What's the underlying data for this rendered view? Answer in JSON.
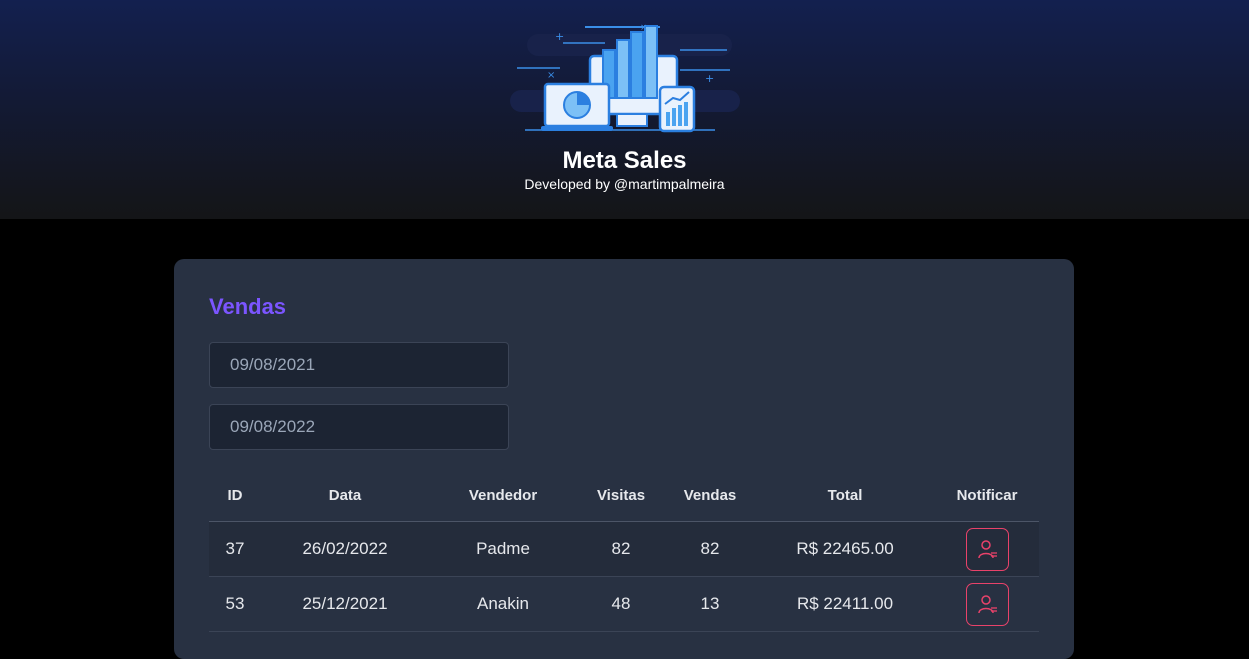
{
  "header": {
    "title": "Meta Sales",
    "subtitle": "Developed by @martimpalmeira",
    "logo_icon": "sales-dashboard-logo"
  },
  "sales_card": {
    "title": "Vendas",
    "min_date": "09/08/2021",
    "max_date": "09/08/2022"
  },
  "table": {
    "headers": [
      "ID",
      "Data",
      "Vendedor",
      "Visitas",
      "Vendas",
      "Total",
      "Notificar"
    ],
    "rows": [
      {
        "id": "37",
        "date": "26/02/2022",
        "seller": "Padme",
        "visits": "82",
        "sales": "82",
        "total": "R$ 22465.00",
        "notify_icon": "notify-user-icon"
      },
      {
        "id": "53",
        "date": "25/12/2021",
        "seller": "Anakin",
        "visits": "48",
        "sales": "13",
        "total": "R$ 22411.00",
        "notify_icon": "notify-user-icon"
      }
    ]
  },
  "colors": {
    "accent": "#7b55ff",
    "notify": "#e9426a",
    "card_bg": "#283142"
  }
}
